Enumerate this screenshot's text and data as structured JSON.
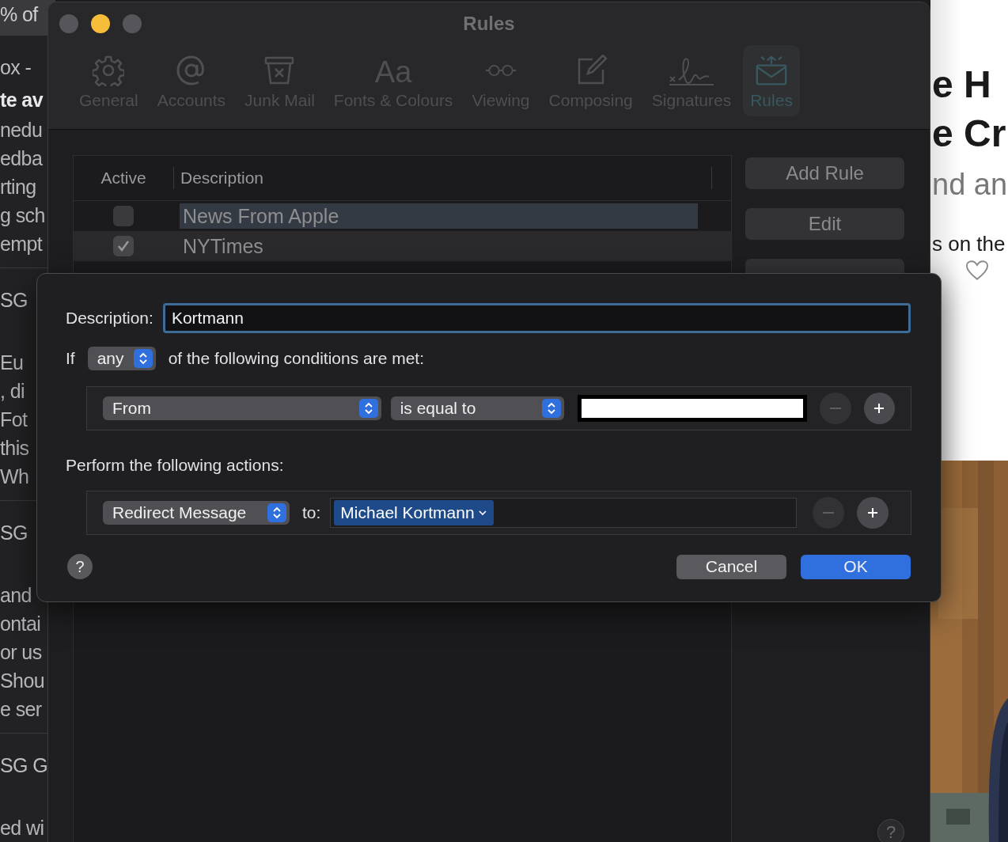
{
  "background_mail_list": {
    "header": "% of",
    "messages": [
      {
        "sender": "ox -",
        "subject": "te av",
        "lines": [
          "nedu",
          "edba",
          "rting",
          "g sch",
          "empt"
        ]
      },
      {
        "sender": "SG",
        "lines": [
          "Eu",
          ", di",
          "Fot",
          "this",
          "Wh"
        ]
      },
      {
        "sender": "SG",
        "lines": [
          "and",
          "ontai",
          "or us",
          "Shou",
          "e ser"
        ]
      },
      {
        "sender": "SG G",
        "lines": [
          "ed wi"
        ]
      }
    ]
  },
  "background_article": {
    "headline_lines": [
      "e H",
      "e Cr"
    ],
    "subtitle": "nd an",
    "byline": "s on the"
  },
  "window": {
    "title": "Rules",
    "toolbar": [
      {
        "label": "General",
        "selected": false
      },
      {
        "label": "Accounts",
        "selected": false
      },
      {
        "label": "Junk Mail",
        "selected": false
      },
      {
        "label": "Fonts & Colours",
        "glyph": "Aa",
        "selected": false
      },
      {
        "label": "Viewing",
        "selected": false
      },
      {
        "label": "Composing",
        "selected": false
      },
      {
        "label": "Signatures",
        "selected": false
      },
      {
        "label": "Rules",
        "selected": true
      }
    ],
    "table": {
      "columns": [
        "Active",
        "Description"
      ],
      "rows": [
        {
          "active": false,
          "description": "News From Apple",
          "selected": false,
          "highlighted": true
        },
        {
          "active": true,
          "description": "NYTimes",
          "selected": true,
          "highlighted": false
        }
      ]
    },
    "buttons": [
      "Add Rule",
      "Edit"
    ],
    "help": "?"
  },
  "sheet": {
    "description_label": "Description:",
    "description": "Kortmann",
    "if_label": "If",
    "match": "any",
    "conditions_text": "of the following conditions are met:",
    "conditions": [
      {
        "field": "From",
        "operator": "is equal to",
        "remove_disabled": true
      }
    ],
    "actions_label": "Perform the following actions:",
    "actions": [
      {
        "action": "Redirect Message",
        "to_label": "to:",
        "recipient": "Michael Kortmann",
        "remove_disabled": true
      }
    ],
    "help": "?",
    "cancel": "Cancel",
    "ok": "OK"
  }
}
